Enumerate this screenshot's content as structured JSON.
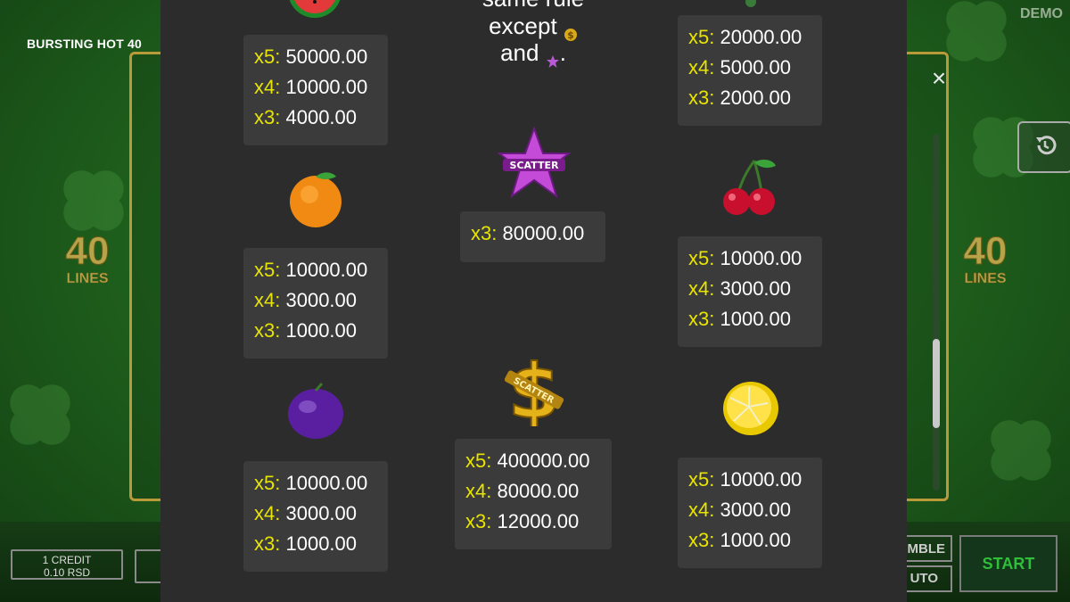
{
  "game": {
    "title": "BURSTING HOT 40",
    "demo": "DEMO",
    "lines_number": "40",
    "lines_label": "LINES"
  },
  "controls": {
    "credit_line1": "1 CREDIT",
    "credit_line2": "0.10 RSD",
    "gamble": "GAMBLE",
    "gamble_visible": "MBLE",
    "auto": "UTO",
    "start": "START",
    "close": "×"
  },
  "intro": {
    "line1": "same rule",
    "line2": "except",
    "line3": "and"
  },
  "symbols": {
    "watermelon": {
      "name": "watermelon",
      "pays": [
        {
          "mul": "x5:",
          "val": "50000.00"
        },
        {
          "mul": "x4:",
          "val": "10000.00"
        },
        {
          "mul": "x3:",
          "val": "4000.00"
        }
      ]
    },
    "orange": {
      "name": "orange",
      "pays": [
        {
          "mul": "x5:",
          "val": "10000.00"
        },
        {
          "mul": "x4:",
          "val": "3000.00"
        },
        {
          "mul": "x3:",
          "val": "1000.00"
        }
      ]
    },
    "plum": {
      "name": "plum",
      "pays": [
        {
          "mul": "x5:",
          "val": "10000.00"
        },
        {
          "mul": "x4:",
          "val": "3000.00"
        },
        {
          "mul": "x3:",
          "val": "1000.00"
        }
      ]
    },
    "star_scatter": {
      "name": "star-scatter",
      "label": "SCATTER",
      "pays": [
        {
          "mul": "x3:",
          "val": "80000.00"
        }
      ]
    },
    "dollar_scatter": {
      "name": "dollar-scatter",
      "label": "SCATTER",
      "pays": [
        {
          "mul": "x5:",
          "val": "400000.00"
        },
        {
          "mul": "x4:",
          "val": "80000.00"
        },
        {
          "mul": "x3:",
          "val": "12000.00"
        }
      ]
    },
    "top_right": {
      "name": "grapes",
      "pays": [
        {
          "mul": "x5:",
          "val": "20000.00"
        },
        {
          "mul": "x4:",
          "val": "5000.00"
        },
        {
          "mul": "x3:",
          "val": "2000.00"
        }
      ]
    },
    "cherry": {
      "name": "cherry",
      "pays": [
        {
          "mul": "x5:",
          "val": "10000.00"
        },
        {
          "mul": "x4:",
          "val": "3000.00"
        },
        {
          "mul": "x3:",
          "val": "1000.00"
        }
      ]
    },
    "lemon": {
      "name": "lemon",
      "pays": [
        {
          "mul": "x5:",
          "val": "10000.00"
        },
        {
          "mul": "x4:",
          "val": "3000.00"
        },
        {
          "mul": "x3:",
          "val": "1000.00"
        }
      ]
    }
  },
  "colors": {
    "multiplier": "#e7e400",
    "panel": "#2c2c2c",
    "box": "#3b3b3b",
    "start": "#2fbf3a"
  }
}
